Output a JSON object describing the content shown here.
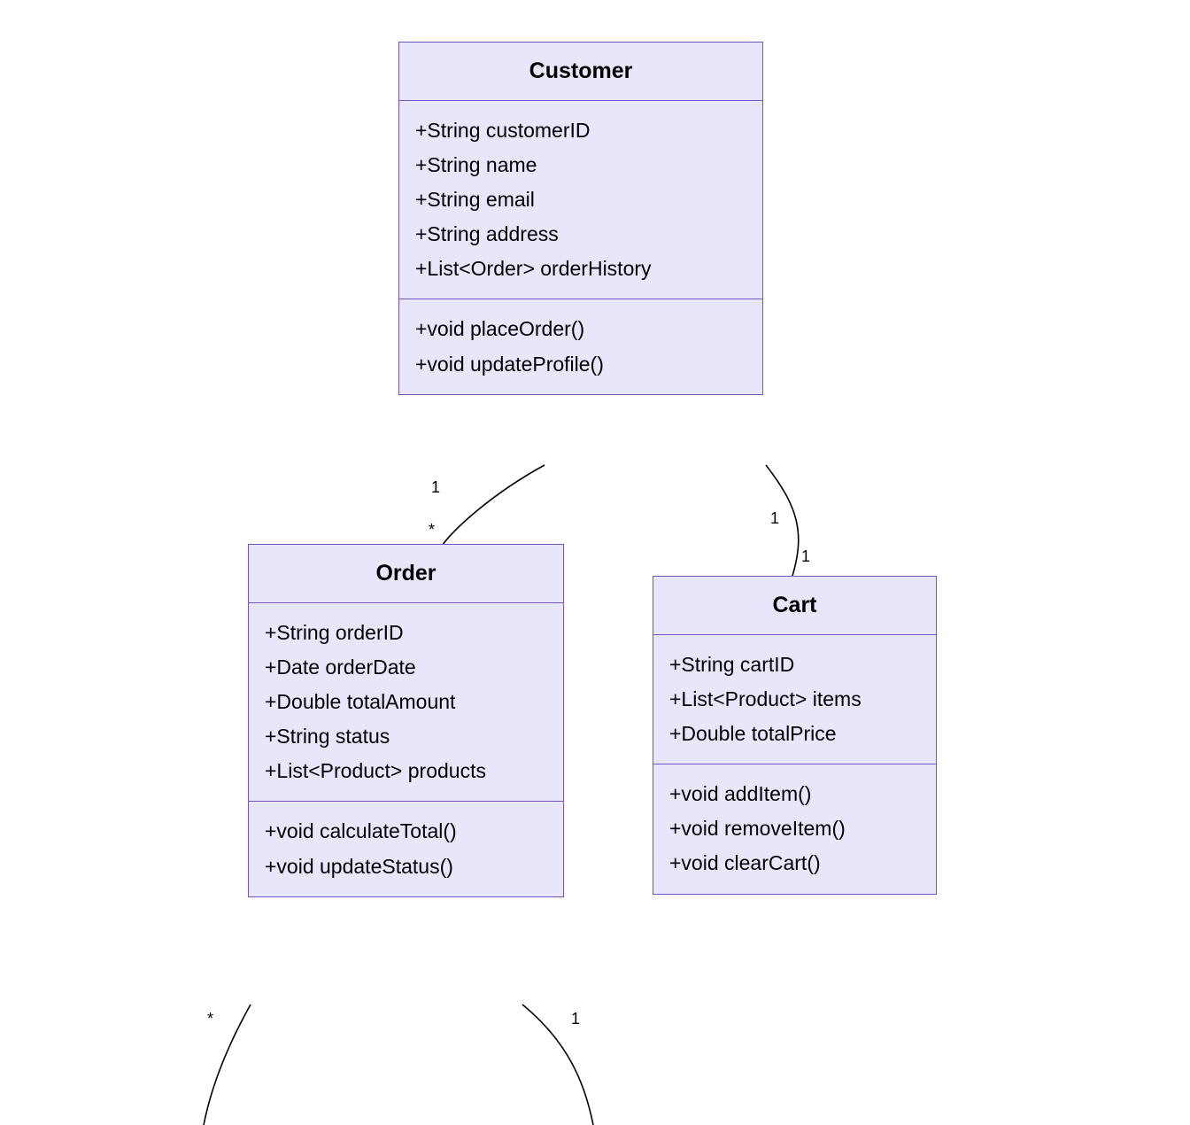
{
  "classes": {
    "customer": {
      "name": "Customer",
      "attributes": [
        "+String customerID",
        "+String name",
        "+String email",
        "+String address",
        "+List<Order> orderHistory"
      ],
      "methods": [
        "+void placeOrder()",
        "+void updateProfile()"
      ]
    },
    "order": {
      "name": "Order",
      "attributes": [
        "+String orderID",
        "+Date orderDate",
        "+Double totalAmount",
        "+String status",
        "+List<Product> products"
      ],
      "methods": [
        "+void calculateTotal()",
        "+void updateStatus()"
      ]
    },
    "cart": {
      "name": "Cart",
      "attributes": [
        "+String cartID",
        "+List<Product> items",
        "+Double totalPrice"
      ],
      "methods": [
        "+void addItem()",
        "+void removeItem()",
        "+void clearCart()"
      ]
    }
  },
  "multiplicities": {
    "custOrder_cust": "1",
    "custOrder_order": "*",
    "custCart_cust": "1",
    "custCart_cart": "1",
    "orderBottom_left": "*",
    "orderBottom_right": "1"
  }
}
